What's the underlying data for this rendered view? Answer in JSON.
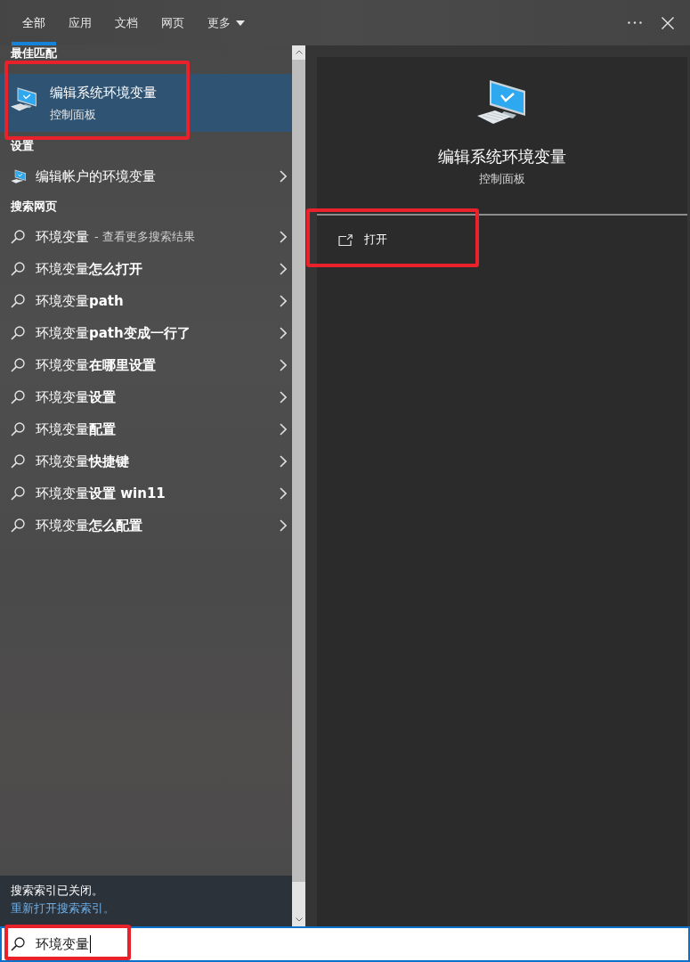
{
  "tabs": [
    {
      "label": "全部",
      "selected": true,
      "dropdown": false
    },
    {
      "label": "应用",
      "selected": false,
      "dropdown": false
    },
    {
      "label": "文档",
      "selected": false,
      "dropdown": false
    },
    {
      "label": "网页",
      "selected": false,
      "dropdown": false
    },
    {
      "label": "更多",
      "selected": false,
      "dropdown": true
    }
  ],
  "results": {
    "best_match": {
      "heading": "最佳匹配",
      "title": "编辑系统环境变量",
      "subtitle": "控制面板",
      "selected": true,
      "annotated": true
    },
    "settings": {
      "heading": "设置",
      "items": [
        {
          "label": "编辑帐户的环境变量",
          "selected": false
        }
      ]
    },
    "web": {
      "heading": "搜索网页",
      "items": [
        {
          "label": "环境变量",
          "hint": "- 查看更多搜索结果",
          "selected": false
        },
        {
          "label": "环境变量**怎么打开**",
          "selected": false
        },
        {
          "label": "环境变量**path**",
          "selected": false
        },
        {
          "label": "环境变量**path变成一行了**",
          "selected": false
        },
        {
          "label": "环境变量**在哪里设置**",
          "selected": false
        },
        {
          "label": "环境变量**设置**",
          "selected": false
        },
        {
          "label": "环境变量**配置**",
          "selected": false
        },
        {
          "label": "环境变量**快捷键**",
          "selected": false
        },
        {
          "label": "环境变量**设置 win11**",
          "selected": false
        },
        {
          "label": "环境变量**怎么配置**",
          "selected": false
        }
      ]
    }
  },
  "index_notice": {
    "text": "搜索索引已关闭。",
    "link": "重新打开搜索索引。"
  },
  "preview": {
    "title": "编辑系统环境变量",
    "subtitle": "控制面板",
    "actions": [
      {
        "label": "打开",
        "annotated": true
      }
    ]
  },
  "search_box": {
    "value": "环境变量",
    "annotated": true
  }
}
